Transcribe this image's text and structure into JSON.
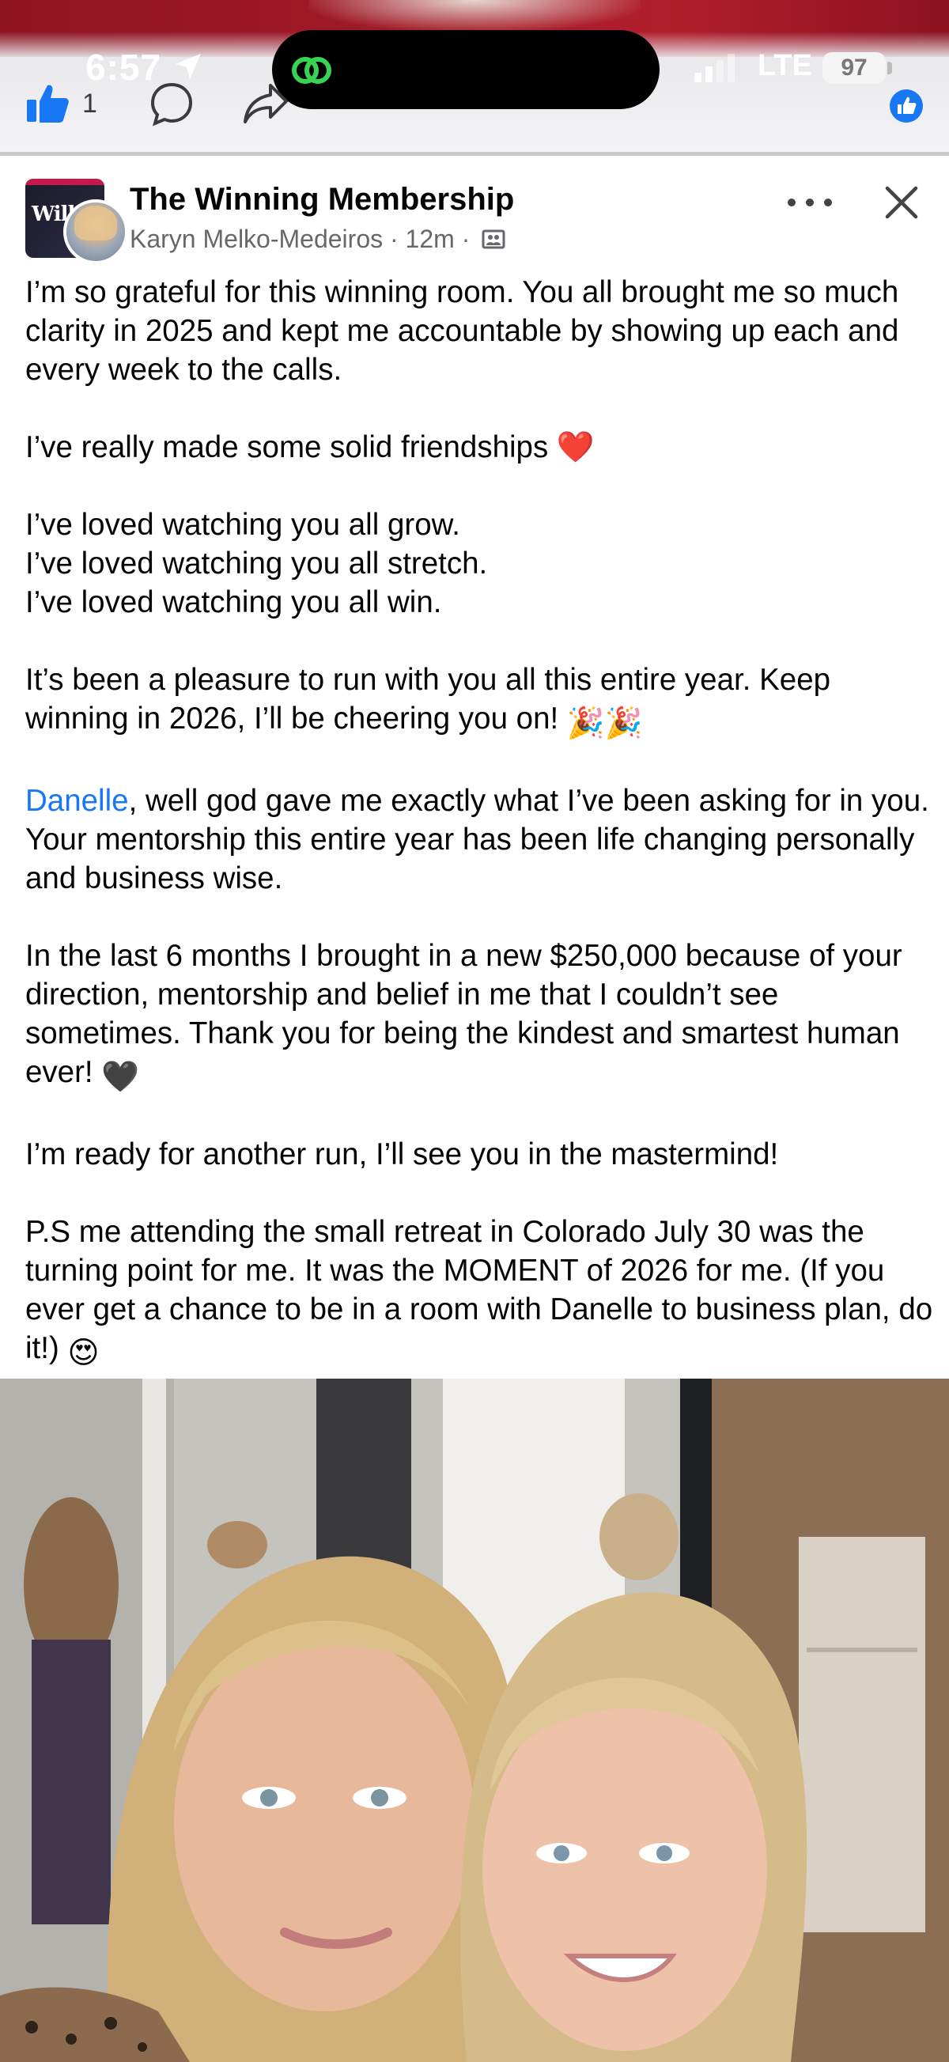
{
  "status_bar": {
    "time": "6:57",
    "network": "LTE",
    "battery": "97"
  },
  "reactions": {
    "like_count": "1"
  },
  "post": {
    "group_name": "The Winning Membership",
    "author": "Karyn Melko-Medeiros",
    "time_ago": "12m",
    "separator": "·",
    "avatar_text": "Will",
    "paragraphs": {
      "p1": "I’m so grateful for this winning room. You all brought me so much clarity in 2025 and kept me accountable by showing up each and every week to the calls.",
      "p2": "I’ve really made some solid friendships",
      "p3_l1": "I’ve loved watching you all grow.",
      "p3_l2": "I’ve loved watching you all stretch.",
      "p3_l3": "I’ve loved watching you all win.",
      "p4": "It’s been a pleasure to run with you all this entire year. Keep winning in 2026, I’ll be cheering you on!",
      "p5_mention": "Danelle",
      "p5_rest": ", well god gave me exactly what I’ve been asking for in you. Your mentorship this entire year has been life changing personally and business wise.",
      "p6": "In the last 6 months I brought in a new $250,000  because of your direction, mentorship and belief in me that I couldn’t see sometimes. Thank you for being the kindest and smartest human ever!",
      "p7": "I’m ready for another run, I’ll see you in the mastermind!",
      "p8": "P.S me attending the small retreat in Colorado July 30 was the turning point for me. It was the MOMENT of 2026 for me. (If you ever get a chance to be in a room with Danelle to business plan, do it!)"
    },
    "emojis": {
      "heart": "❤️",
      "party": "🎉🎉",
      "black_heart": "🖤",
      "heart_eyes": "😍"
    }
  },
  "colors": {
    "link": "#1877f2",
    "meta": "#65676b",
    "like_blue": "#1877f2"
  },
  "icons": [
    "location-arrow-icon",
    "threads-icon",
    "signal-icon",
    "battery-icon",
    "like-icon",
    "comment-icon",
    "share-icon",
    "like-badge-icon",
    "audience-icon",
    "more-icon",
    "close-icon"
  ]
}
